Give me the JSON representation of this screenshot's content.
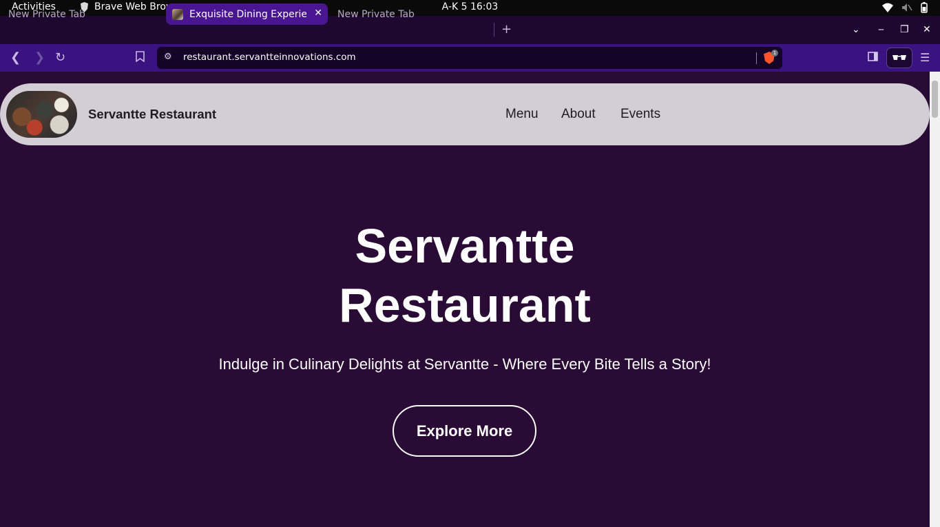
{
  "system_bar": {
    "activities": "Activities",
    "app_name": "Brave Web Browser",
    "clock": "A-K 5  16:03"
  },
  "tabs": [
    {
      "title": "New Private Tab",
      "active": false
    },
    {
      "title": "Exquisite Dining Experience",
      "active": true
    },
    {
      "title": "New Private Tab",
      "active": false
    }
  ],
  "toolbar": {
    "url": "restaurant.servantteinnovations.com",
    "shield_count": "1"
  },
  "site": {
    "brand": "Servantte Restaurant",
    "nav": [
      "Menu",
      "About",
      "Events"
    ],
    "hero_title_line1": "Servantte",
    "hero_title_line2": "Restaurant",
    "hero_subtitle": "Indulge in Culinary Delights at Servantte - Where Every Bite Tells a Story!",
    "cta": "Explore More"
  },
  "colors": {
    "page_bg": "#290b35",
    "nav_bg": "#d3cdd6",
    "tab_active": "#4a1590",
    "toolbar_bg": "#3a1380"
  }
}
